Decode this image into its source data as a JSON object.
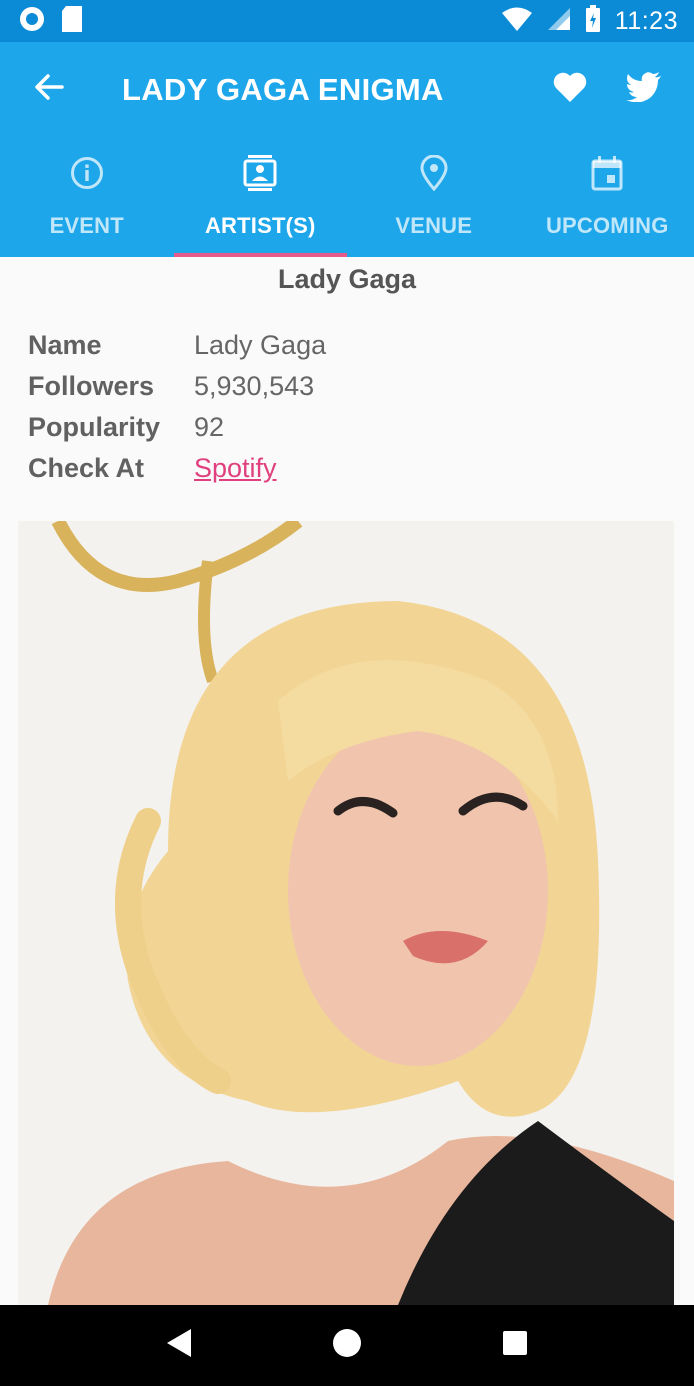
{
  "status_bar": {
    "time": "11:23",
    "icons": [
      "record-icon",
      "sd-card-icon",
      "wifi-icon",
      "signal-icon",
      "battery-icon"
    ]
  },
  "app_bar": {
    "title": "LADY GAGA ENIGMA",
    "back_icon": "back-arrow-icon",
    "actions": [
      "favorite-heart-icon",
      "twitter-share-icon"
    ]
  },
  "tabs": [
    {
      "label": "EVENT",
      "icon": "info-icon",
      "active": false
    },
    {
      "label": "ARTIST(S)",
      "icon": "artist-card-icon",
      "active": true
    },
    {
      "label": "VENUE",
      "icon": "location-pin-icon",
      "active": false
    },
    {
      "label": "UPCOMING",
      "icon": "calendar-icon",
      "active": false
    }
  ],
  "artist": {
    "heading": "Lady Gaga",
    "rows": [
      {
        "key": "Name",
        "value": "Lady Gaga"
      },
      {
        "key": "Followers",
        "value": "5,930,543"
      },
      {
        "key": "Popularity",
        "value": "92"
      },
      {
        "key": "Check At",
        "value": "Spotify",
        "link": true
      }
    ]
  },
  "photo": {
    "subject": "artist-photo"
  },
  "nav_bar": {
    "buttons": [
      "back-triangle-icon",
      "home-circle-icon",
      "recents-square-icon"
    ]
  },
  "colors": {
    "status_bar": "#0b8ad6",
    "app_bar": "#1ea6ea",
    "tab_indicator": "#e65a8c",
    "link": "#e0407d"
  }
}
